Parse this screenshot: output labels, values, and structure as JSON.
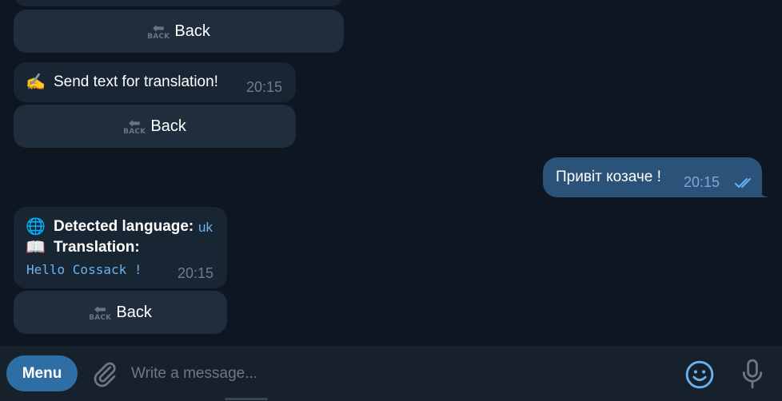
{
  "messages": {
    "back_label": "Back",
    "back_icon_text": "BACK",
    "prompt_text": "Send text for translation!",
    "prompt_emoji": "✍️",
    "prompt_time": "20:15",
    "outgoing_text": "Привіт козаче !",
    "outgoing_time": "20:15",
    "result": {
      "detected_emoji": "🌐",
      "detected_label": "Detected language:",
      "detected_value": "uk",
      "translation_emoji": "📖",
      "translation_label": "Translation:",
      "translation_text": "Hello Cossack !",
      "time": "20:15"
    }
  },
  "input_bar": {
    "menu_label": "Menu",
    "placeholder": "Write a message..."
  },
  "icons": {
    "attach": "paperclip-icon",
    "emoji": "smiley-icon",
    "mic": "microphone-icon",
    "read_receipt": "double-check-icon"
  },
  "colors": {
    "background": "#0e1621",
    "bubble_in": "#182533",
    "bubble_out": "#2b5278",
    "accent": "#6ab3f3",
    "menu_button": "#2f6ea5"
  }
}
